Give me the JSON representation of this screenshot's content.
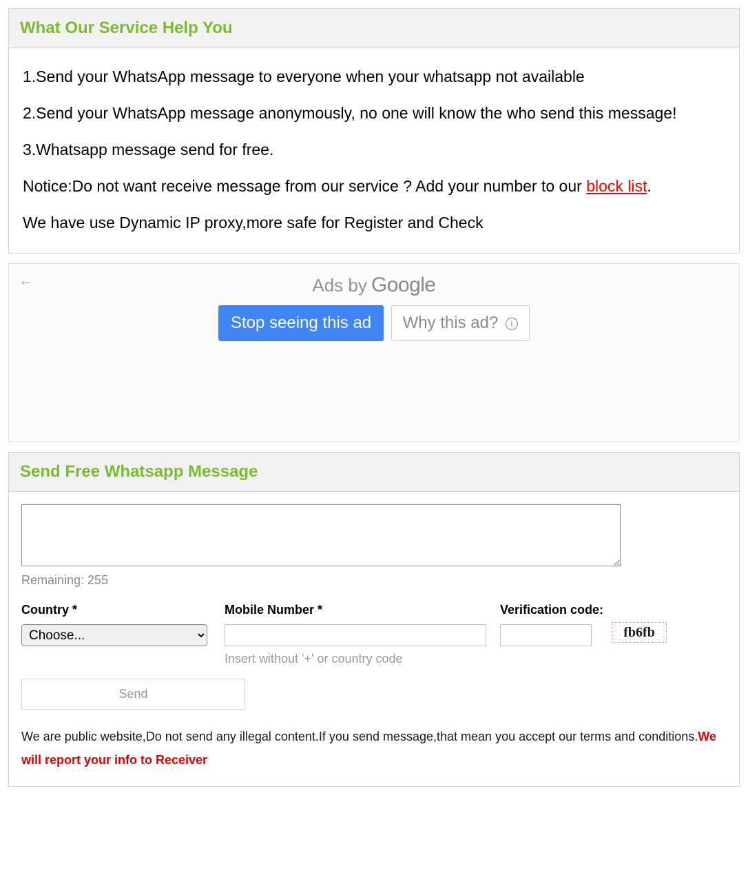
{
  "panel1": {
    "title": "What Our Service Help You",
    "items": [
      "1.Send your WhatsApp message to everyone when your whatsapp not available",
      "2.Send your WhatsApp message anonymously, no one will know the who send this message!",
      "3.Whatsapp message send for free."
    ],
    "notice_prefix": "Notice:Do not want receive message from our service ? Add your number to our ",
    "notice_link": "block list",
    "notice_suffix": ".",
    "proxy_text": "We have use Dynamic IP proxy,more safe for Register and Check"
  },
  "ad": {
    "ads_by": "Ads by",
    "google": "Google",
    "stop_label": "Stop seeing this ad",
    "why_label": "Why this ad?"
  },
  "panel2": {
    "title": "Send Free Whatsapp Message",
    "remaining_label": "Remaining: 255",
    "country_label": "Country *",
    "country_placeholder": "Choose...",
    "mobile_label": "Mobile Number *",
    "mobile_hint": "Insert without '+' or country code",
    "verify_label": "Verification code:",
    "captcha_text": "fb6fb",
    "send_label": "Send",
    "disclaimer_main": "We are public website,Do not send any illegal content.If you send message,that mean you accept our terms and conditions.",
    "disclaimer_warn": "We will report your info to Receiver"
  }
}
